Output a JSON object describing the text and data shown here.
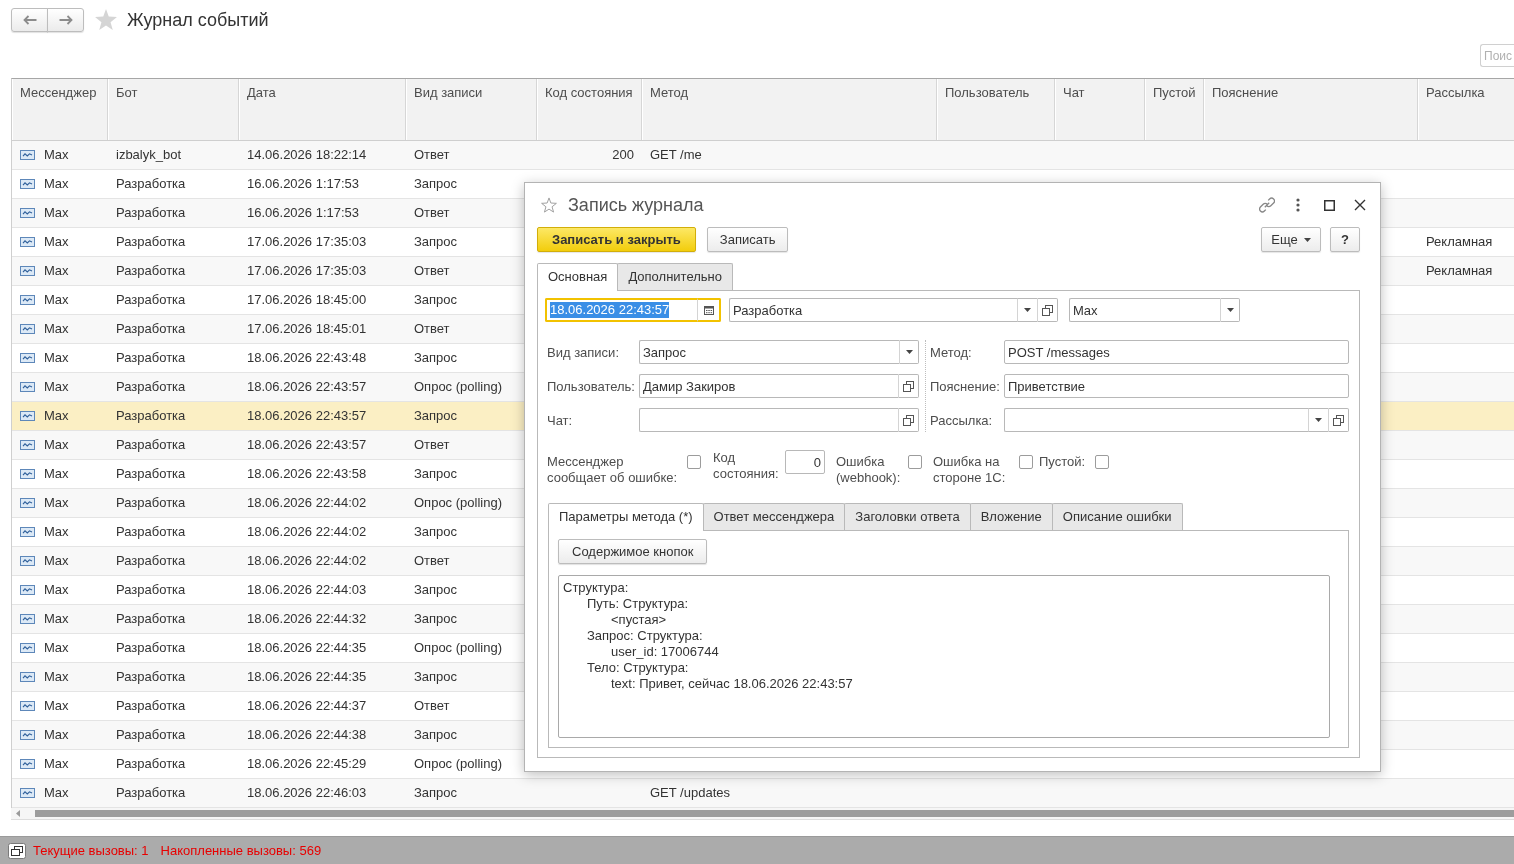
{
  "window": {
    "title": "Журнал событий"
  },
  "search": {
    "placeholder": "Поис"
  },
  "table": {
    "columns": [
      "Мессенджер",
      "Бот",
      "Дата",
      "Вид записи",
      "Код состояния",
      "Метод",
      "Пользователь",
      "Чат",
      "Пустой",
      "Пояснение",
      "Рассылка"
    ],
    "rows": [
      {
        "messenger": "Max",
        "bot": "izbalyk_bot",
        "date": "14.06.2026 18:22:14",
        "record_type": "Ответ",
        "status_code": "200",
        "method": "GET /me",
        "selected": false
      },
      {
        "messenger": "Max",
        "bot": "Разработка",
        "date": "16.06.2026 1:17:53",
        "record_type": "Запрос",
        "selected": false
      },
      {
        "messenger": "Max",
        "bot": "Разработка",
        "date": "16.06.2026 1:17:53",
        "record_type": "Ответ",
        "selected": false
      },
      {
        "messenger": "Max",
        "bot": "Разработка",
        "date": "17.06.2026 17:35:03",
        "record_type": "Запрос",
        "mailing": "Рекламная",
        "selected": false
      },
      {
        "messenger": "Max",
        "bot": "Разработка",
        "date": "17.06.2026 17:35:03",
        "record_type": "Ответ",
        "mailing": "Рекламная",
        "selected": false
      },
      {
        "messenger": "Max",
        "bot": "Разработка",
        "date": "17.06.2026 18:45:00",
        "record_type": "Запрос",
        "selected": false
      },
      {
        "messenger": "Max",
        "bot": "Разработка",
        "date": "17.06.2026 18:45:01",
        "record_type": "Ответ",
        "selected": false
      },
      {
        "messenger": "Max",
        "bot": "Разработка",
        "date": "18.06.2026 22:43:48",
        "record_type": "Запрос",
        "selected": false
      },
      {
        "messenger": "Max",
        "bot": "Разработка",
        "date": "18.06.2026 22:43:57",
        "record_type": "Опрос (polling)",
        "selected": false
      },
      {
        "messenger": "Max",
        "bot": "Разработка",
        "date": "18.06.2026 22:43:57",
        "record_type": "Запрос",
        "selected": true
      },
      {
        "messenger": "Max",
        "bot": "Разработка",
        "date": "18.06.2026 22:43:57",
        "record_type": "Ответ",
        "selected": false
      },
      {
        "messenger": "Max",
        "bot": "Разработка",
        "date": "18.06.2026 22:43:58",
        "record_type": "Запрос",
        "selected": false
      },
      {
        "messenger": "Max",
        "bot": "Разработка",
        "date": "18.06.2026 22:44:02",
        "record_type": "Опрос (polling)",
        "selected": false
      },
      {
        "messenger": "Max",
        "bot": "Разработка",
        "date": "18.06.2026 22:44:02",
        "record_type": "Запрос",
        "selected": false
      },
      {
        "messenger": "Max",
        "bot": "Разработка",
        "date": "18.06.2026 22:44:02",
        "record_type": "Ответ",
        "selected": false
      },
      {
        "messenger": "Max",
        "bot": "Разработка",
        "date": "18.06.2026 22:44:03",
        "record_type": "Запрос",
        "selected": false
      },
      {
        "messenger": "Max",
        "bot": "Разработка",
        "date": "18.06.2026 22:44:32",
        "record_type": "Запрос",
        "selected": false
      },
      {
        "messenger": "Max",
        "bot": "Разработка",
        "date": "18.06.2026 22:44:35",
        "record_type": "Опрос (polling)",
        "selected": false
      },
      {
        "messenger": "Max",
        "bot": "Разработка",
        "date": "18.06.2026 22:44:35",
        "record_type": "Запрос",
        "selected": false
      },
      {
        "messenger": "Max",
        "bot": "Разработка",
        "date": "18.06.2026 22:44:37",
        "record_type": "Ответ",
        "selected": false
      },
      {
        "messenger": "Max",
        "bot": "Разработка",
        "date": "18.06.2026 22:44:38",
        "record_type": "Запрос",
        "selected": false
      },
      {
        "messenger": "Max",
        "bot": "Разработка",
        "date": "18.06.2026 22:45:29",
        "record_type": "Опрос (polling)",
        "selected": false
      },
      {
        "messenger": "Max",
        "bot": "Разработка",
        "date": "18.06.2026 22:46:03",
        "record_type": "Запрос",
        "method": "GET /updates",
        "selected": false
      }
    ]
  },
  "dialog": {
    "title": "Запись журнала",
    "buttons": [
      {
        "label": "Записать и закрыть",
        "kind": "primary"
      },
      {
        "label": "Записать",
        "kind": "default"
      }
    ],
    "more_button": "Еще",
    "help_button": "?",
    "tabs": [
      {
        "label": "Основная",
        "selected": true
      },
      {
        "label": "Дополнительно",
        "selected": false
      }
    ],
    "header_fields": [
      {
        "kind": "date",
        "value": "18.06.2026 22:43:57",
        "focused": true
      },
      {
        "kind": "select_link",
        "value": "Разработка"
      },
      {
        "kind": "select",
        "value": "Max"
      }
    ],
    "fields_left": [
      {
        "label": "Вид записи:",
        "kind": "select",
        "value": "Запрос"
      },
      {
        "label": "Пользователь:",
        "kind": "link",
        "value": "Дамир Закиров"
      },
      {
        "label": "Чат:",
        "kind": "link"
      }
    ],
    "fields_right": [
      {
        "label": "Метод:",
        "kind": "text",
        "value": "POST /messages"
      },
      {
        "label": "Пояснение:",
        "kind": "text",
        "value": "Приветствие"
      },
      {
        "label": "Рассылка:",
        "kind": "select_link"
      }
    ],
    "flags": [
      {
        "label": "Мессенджер сообщает об ошибке:",
        "kind": "checkbox",
        "checked": false
      },
      {
        "label": "Код состояния:",
        "kind": "number",
        "value": "0"
      },
      {
        "label": "Ошибка (webhook):",
        "kind": "checkbox",
        "checked": false
      },
      {
        "label": "Ошибка на стороне 1С:",
        "kind": "checkbox",
        "checked": false
      },
      {
        "label": "Пустой:",
        "kind": "checkbox",
        "checked": false
      }
    ],
    "inner_tabs": [
      {
        "label": "Параметры метода (*)",
        "selected": true
      },
      {
        "label": "Ответ мессенджера",
        "selected": false
      },
      {
        "label": "Заголовки ответа",
        "selected": false
      },
      {
        "label": "Вложение",
        "selected": false
      },
      {
        "label": "Описание ошибки",
        "selected": false
      }
    ],
    "content_button": "Содержимое кнопок",
    "structure": [
      {
        "text": "Структура:",
        "children": [
          {
            "text": "Путь: Структура:",
            "children": [
              {
                "text": "<пустая>"
              }
            ]
          },
          {
            "text": "Запрос: Структура:",
            "children": [
              {
                "text": "user_id: 17006744"
              }
            ]
          },
          {
            "text": "Тело: Структура:",
            "children": [
              {
                "text": "text: Привет, сейчас 18.06.2026 22:43:57"
              }
            ]
          }
        ]
      }
    ]
  },
  "status_bar": {
    "items": [
      "Текущие вызовы: 1",
      "Накопленные вызовы: 569"
    ]
  }
}
